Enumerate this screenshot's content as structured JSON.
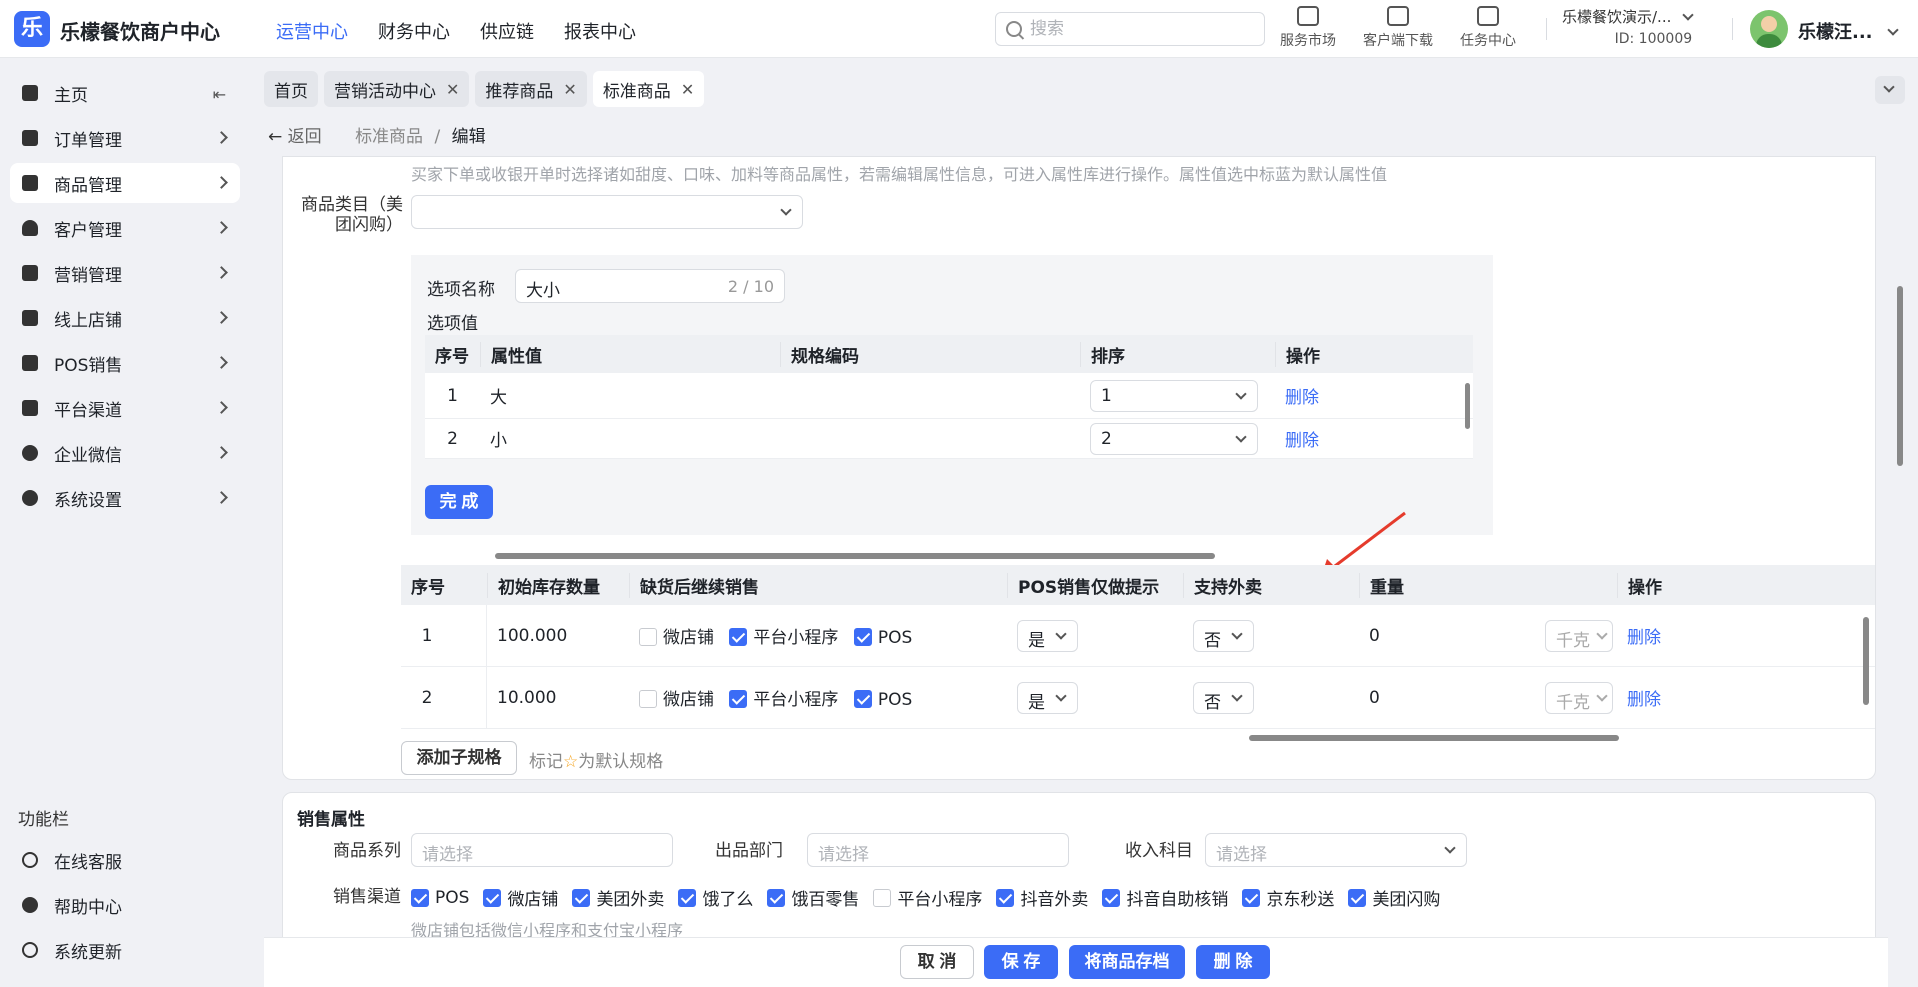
{
  "app": {
    "brand": "乐檬餐饮商户中心",
    "logo_letter": "乐"
  },
  "topnav": [
    "运营中心",
    "财务中心",
    "供应链",
    "报表中心"
  ],
  "search": {
    "placeholder": "搜索"
  },
  "tools": [
    "服务市场",
    "客户端下载",
    "任务中心"
  ],
  "store": {
    "name": "乐檬餐饮演示/...",
    "id": "ID: 100009"
  },
  "user": {
    "name": "乐檬汪..."
  },
  "sidebar": {
    "items": [
      "主页",
      "订单管理",
      "商品管理",
      "客户管理",
      "营销管理",
      "线上店铺",
      "POS销售",
      "平台渠道",
      "企业微信",
      "系统设置"
    ],
    "section_title": "功能栏",
    "func_items": [
      "在线客服",
      "帮助中心",
      "系统更新"
    ]
  },
  "tabs": [
    "首页",
    "营销活动中心",
    "推荐商品",
    "标准商品"
  ],
  "breadcrumb": {
    "back": "返回",
    "parent": "标准商品",
    "sep": "/",
    "current": "编辑"
  },
  "form": {
    "attr_hint": "买家下单或收银开单时选择诸如甜度、口味、加料等商品属性，若需编辑属性信息，可进入属性库进行操作。属性值选中标蓝为默认属性值",
    "category_label": "商品类目（美团闪购）",
    "option": {
      "name_label": "选项名称",
      "name_value": "大小",
      "name_count": "2 / 10",
      "values_label": "选项值",
      "headers": [
        "序号",
        "属性值",
        "规格编码",
        "排序",
        "操作"
      ],
      "rows": [
        {
          "no": "1",
          "value": "大",
          "code": "",
          "sort": "1",
          "action": "删除"
        },
        {
          "no": "2",
          "value": "小",
          "code": "",
          "sort": "2",
          "action": "删除"
        }
      ],
      "done_label": "完 成"
    },
    "sku_table": {
      "headers": [
        "序号",
        "",
        "初始库存数量",
        "缺货后继续销售",
        "POS销售仅做提示",
        "支持外卖",
        "重量",
        "",
        "操作"
      ],
      "channels": [
        "微店铺",
        "平台小程序",
        "POS"
      ],
      "rows": [
        {
          "no": "1",
          "stock": "100.000",
          "ch_on": [
            false,
            true,
            true
          ],
          "pos_tip": "是",
          "takeout": "否",
          "weight": "0",
          "unit": "千克",
          "action": "删除"
        },
        {
          "no": "2",
          "stock": "10.000",
          "ch_on": [
            false,
            true,
            true
          ],
          "pos_tip": "是",
          "takeout": "否",
          "weight": "0",
          "unit": "千克",
          "action": "删除"
        }
      ]
    },
    "add_sub_spec": "添加子规格",
    "default_mark_prefix": "标记",
    "default_mark_suffix": "为默认规格"
  },
  "sales": {
    "title": "销售属性",
    "series_label": "商品系列",
    "series_placeholder": "请选择",
    "dept_label": "出品部门",
    "dept_placeholder": "请选择",
    "income_label": "收入科目",
    "income_placeholder": "请选择",
    "channels_label": "销售渠道",
    "channels": [
      {
        "name": "POS",
        "on": true
      },
      {
        "name": "微店铺",
        "on": true
      },
      {
        "name": "美团外卖",
        "on": true
      },
      {
        "name": "饿了么",
        "on": true
      },
      {
        "name": "饿百零售",
        "on": true
      },
      {
        "name": "平台小程序",
        "on": false
      },
      {
        "name": "抖音外卖",
        "on": true
      },
      {
        "name": "抖音自助核销",
        "on": true
      },
      {
        "name": "京东秒送",
        "on": true
      },
      {
        "name": "美团闪购",
        "on": true
      }
    ],
    "channels_note": "微店铺包括微信小程序和支付宝小程序"
  },
  "actions": {
    "cancel": "取 消",
    "save": "保 存",
    "archive": "将商品存档",
    "delete": "删 除"
  },
  "colors": {
    "accent": "#3b6cf6",
    "arrow": "#e53b2c"
  }
}
